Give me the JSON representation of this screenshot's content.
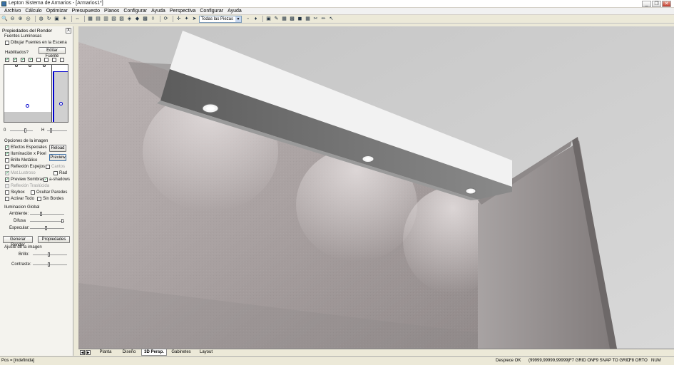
{
  "window": {
    "title": "Lepton Sistema de Armarios - [Armarios1*]",
    "buttons": [
      "_",
      "❐",
      "✕"
    ]
  },
  "menu": [
    "Archivo",
    "Cálculo",
    "Optimizar",
    "Presupuesto",
    "Planos",
    "Configurar",
    "Ayuda",
    "Perspectiva",
    "Configurar",
    "Ayuda"
  ],
  "toolbar": {
    "filter_value": "Todas las Piezas"
  },
  "panel": {
    "title": "Propiedades del Render",
    "close": "X",
    "lights_group": "Fuentes Luminosas",
    "draw_lights": "Dibujar Fuentes en la Escena",
    "enabled_label": "Habilitados?",
    "edit_light": "Editar Fuente",
    "light_checks": [
      true,
      true,
      true,
      true,
      false,
      false,
      false,
      false
    ],
    "slider_o": "0",
    "slider_h": "H",
    "image_options_group": "Opciones de la imagen",
    "special_effects": "Efectos Especiales",
    "reload": "Reload",
    "pixel_lighting": "Iluminación x Pixel",
    "preview": "Preview",
    "metallic_shine": "Brillo Metálico",
    "mirror_reflection": "Reflexión Espejos",
    "edges": "Cantos",
    "glossy_mat": "Mat.Lustroso",
    "rad": "Rad",
    "preview_shadows": "Preview Sombras",
    "a_shadows": "a-shadows",
    "translucent_reflection": "Reflexión Traslúcida",
    "skybox": "Skybox",
    "hide_walls": "Ocultar Paredes",
    "activate_all": "Activar Todo",
    "no_borders": "Sin Bordes",
    "global_illumination_group": "Iluminacion Global",
    "ambient": "Ambiente:",
    "diffuse": "Difusa",
    "specular": "Especular:",
    "generate_render": "Generar Render",
    "properties": "Propiedades",
    "image_adjust_group": "Ajuste de la imagen",
    "brightness": "Brillo:",
    "contrast": "Contraste:"
  },
  "tabs": [
    "Planta",
    "Diseño",
    "3D Persp.",
    "Gabinetes",
    "Layout"
  ],
  "active_tab": "3D Persp.",
  "status": {
    "pos": "Pos = [indefinida]",
    "snap_info": "Despiece OK",
    "coords": "(99999,99999,99999)",
    "grid": "F7 GRID ON",
    "snap_grid": "F9 SNAP TO GRID",
    "ortho": "F8 ORTO",
    "num": "NUM"
  },
  "colors": {
    "wall": "#a8a0a0",
    "ceiling": "#cfcfcf",
    "beam_front": "#6f6f6f",
    "beam_top": "#f2f2f2",
    "accent": "#0000cc"
  }
}
